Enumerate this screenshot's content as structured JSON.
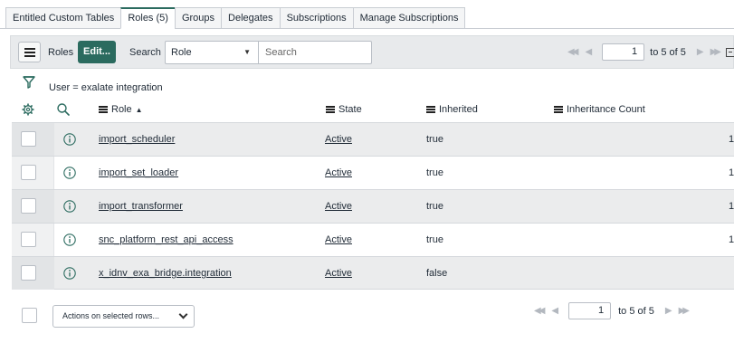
{
  "tabs": [
    {
      "label": "Entitled Custom Tables",
      "active": false
    },
    {
      "label": "Roles (5)",
      "active": true
    },
    {
      "label": "Groups",
      "active": false
    },
    {
      "label": "Delegates",
      "active": false
    },
    {
      "label": "Subscriptions",
      "active": false
    },
    {
      "label": "Manage Subscriptions",
      "active": false
    }
  ],
  "toolbar": {
    "list_title": "Roles",
    "edit_label": "Edit...",
    "search_label": "Search",
    "search_field": "Role",
    "search_placeholder": "Search"
  },
  "pagination": {
    "first_icon": "double-chevron-left-icon",
    "prev_icon": "chevron-left-icon",
    "next_icon": "chevron-right-icon",
    "last_icon": "double-chevron-right-icon",
    "current_page": "1",
    "range_text": "to 5 of 5"
  },
  "filter": {
    "text": "User = exalate integration"
  },
  "columns": {
    "role": "Role",
    "sort_indicator": "▲",
    "state": "State",
    "inherited": "Inherited",
    "inheritance_count": "Inheritance Count"
  },
  "rows": [
    {
      "role": "import_scheduler",
      "state": "Active",
      "inherited": "true",
      "count": "1"
    },
    {
      "role": "import_set_loader",
      "state": "Active",
      "inherited": "true",
      "count": "1"
    },
    {
      "role": "import_transformer",
      "state": "Active",
      "inherited": "true",
      "count": "1"
    },
    {
      "role": "snc_platform_rest_api_access",
      "state": "Active",
      "inherited": "true",
      "count": "1"
    },
    {
      "role": "x_idnv_exa_bridge.integration",
      "state": "Active",
      "inherited": "false",
      "count": ""
    }
  ],
  "footer": {
    "actions_placeholder": "Actions on selected rows...",
    "current_page": "1",
    "range_text": "to 5 of 5"
  },
  "colors": {
    "accent": "#2b6b5f",
    "toolbar_bg": "#e8eaec",
    "row_alt": "#ebeced"
  }
}
